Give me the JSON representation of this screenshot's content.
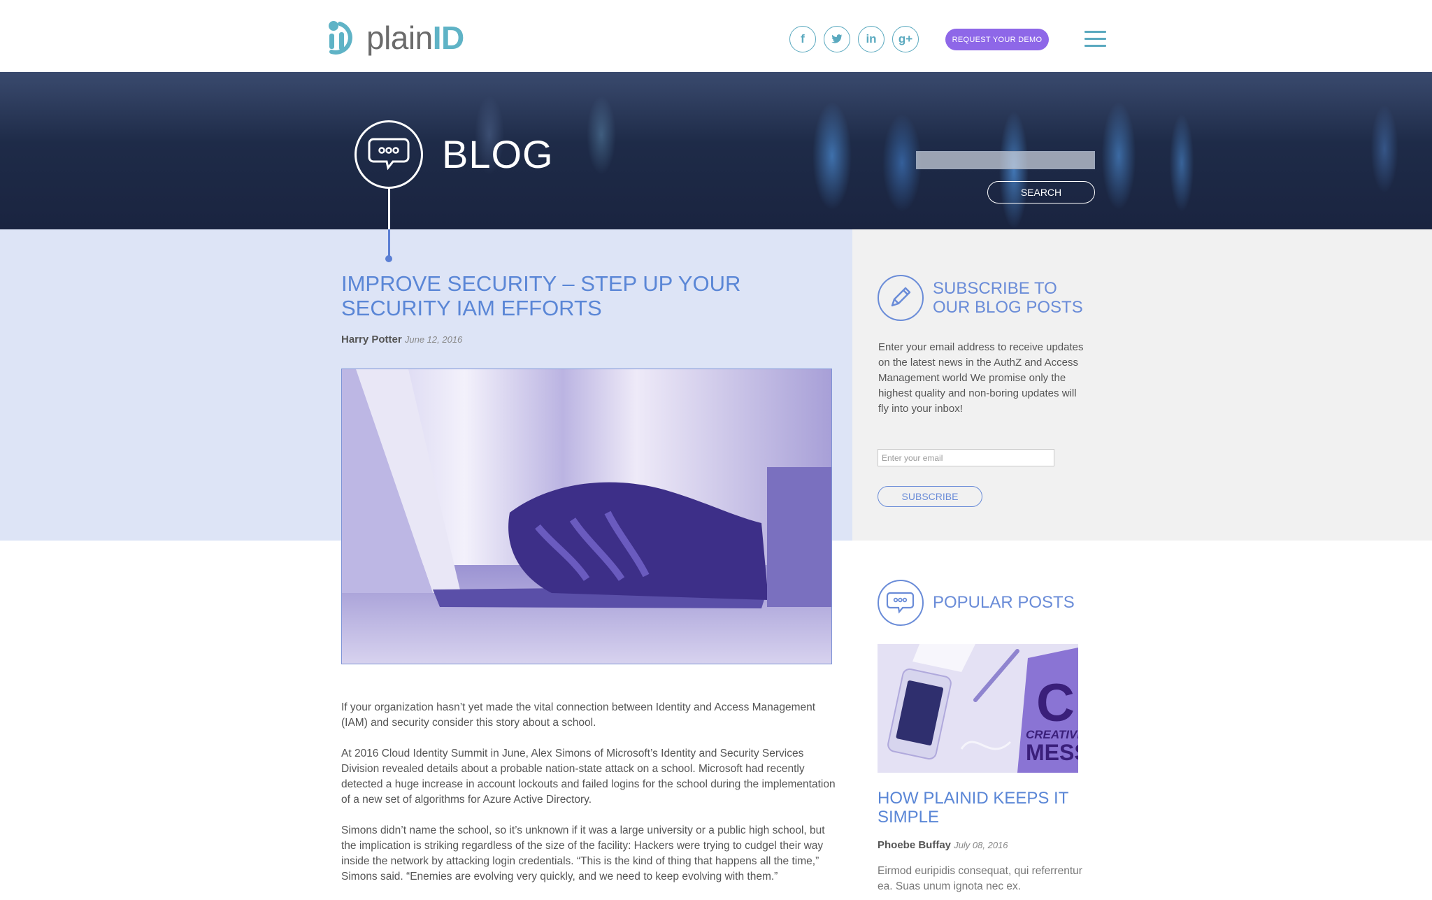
{
  "header": {
    "logo_prefix": "plain",
    "logo_suffix": "ID",
    "social": [
      {
        "icon": "facebook-icon",
        "glyph": "f"
      },
      {
        "icon": "twitter-icon",
        "glyph": "t"
      },
      {
        "icon": "linkedin-icon",
        "glyph": "in"
      },
      {
        "icon": "google-plus-icon",
        "glyph": "g+"
      }
    ],
    "demo_button": "REQUEST YOUR DEMO",
    "menu_icon": "hamburger-menu-icon"
  },
  "hero": {
    "title": "BLOG",
    "search_value": "",
    "search_button": "SEARCH"
  },
  "article": {
    "title": "IMPROVE SECURITY – STEP UP YOUR SECURITY IAM EFFORTS",
    "author": "Harry Potter",
    "date": "June 12, 2016",
    "paragraphs": [
      "If your organization hasn’t yet made the vital connection between Identity and Access Management (IAM) and security consider this story about a school.",
      "At 2016 Cloud Identity Summit in June, Alex Simons of Microsoft’s Identity and Security Services Division revealed details about a probable nation-state attack on a school. Microsoft had recently detected a huge increase in account lockouts and failed logins for the school during the implementation of a new set of algorithms for Azure Active Directory.",
      "Simons didn’t name the school, so it’s unknown if it was a large university or a public high school, but the implication is striking regardless of the size of the facility: Hackers were trying to cudgel their way inside the network by attacking login credentials. “This is the kind of thing that happens all the time,” Simons said. “Enemies are evolving very quickly, and we need to keep evolving with them.”"
    ]
  },
  "sidebar": {
    "subscribe": {
      "heading_line1": "SUBSCRIBE TO",
      "heading_line2": "OUR BLOG POSTS",
      "text": "Enter your email address to receive updates on the latest news in the AuthZ and Access Management world We promise only the highest quality and non-boring updates will fly into your inbox!",
      "email_placeholder": "Enter your email",
      "button": "SUBSCRIBE"
    },
    "popular": {
      "heading": "POPULAR POSTS",
      "post_title": "HOW PLAINID KEEPS IT SIMPLE",
      "author": "Phoebe Buffay",
      "date": "July 08, 2016",
      "excerpt": "Eirmod euripidis consequat, qui referrentur ea. Suas unum ignota nec ex.",
      "image_text_big": "C",
      "image_text_line1": "CREATIVE",
      "image_text_line2": "MESS"
    }
  },
  "colors": {
    "accent_blue": "#5a86d6",
    "brand_teal": "#5fb3c6",
    "demo_purple": "#8e67e8",
    "left_band": "#dde4f6",
    "right_band": "#f1f1f1"
  }
}
